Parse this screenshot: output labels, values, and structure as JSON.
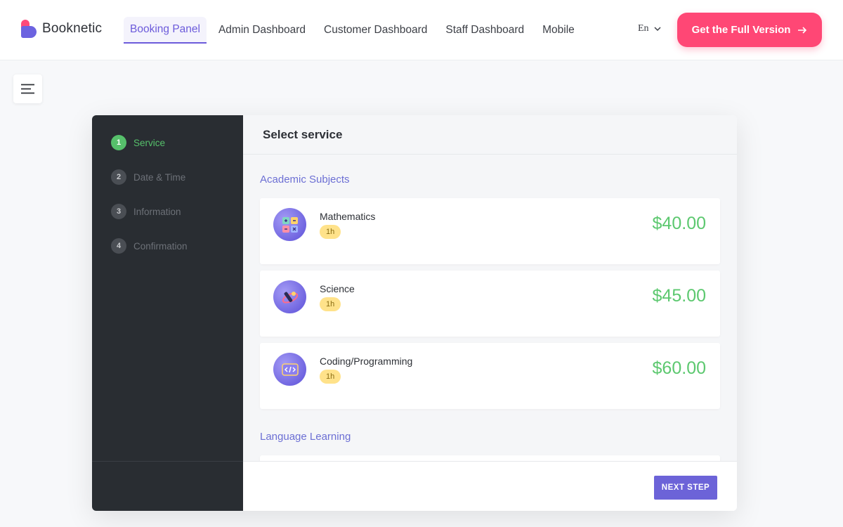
{
  "brand": {
    "name": "Booknetic"
  },
  "nav": {
    "items": [
      {
        "label": "Booking Panel",
        "active": true
      },
      {
        "label": "Admin Dashboard",
        "active": false
      },
      {
        "label": "Customer Dashboard",
        "active": false
      },
      {
        "label": "Staff Dashboard",
        "active": false
      },
      {
        "label": "Mobile",
        "active": false
      }
    ],
    "language": "En",
    "cta_label": "Get the Full Version"
  },
  "colors": {
    "accent": "#6c5bdb",
    "cta": "#ff4775",
    "price": "#5cc86f",
    "sidebar": "#292d32",
    "step_active": "#56c06b"
  },
  "steps": [
    {
      "num": "1",
      "label": "Service",
      "active": true
    },
    {
      "num": "2",
      "label": "Date & Time",
      "active": false
    },
    {
      "num": "3",
      "label": "Information",
      "active": false
    },
    {
      "num": "4",
      "label": "Confirmation",
      "active": false
    }
  ],
  "main": {
    "title": "Select service",
    "categories": [
      {
        "name": "Academic Subjects",
        "services": [
          {
            "name": "Mathematics",
            "duration": "1h",
            "price": "$40.00",
            "icon": "calculator-icon"
          },
          {
            "name": "Science",
            "duration": "1h",
            "price": "$45.00",
            "icon": "telescope-icon"
          },
          {
            "name": "Coding/Programming",
            "duration": "1h",
            "price": "$60.00",
            "icon": "code-icon"
          }
        ]
      },
      {
        "name": "Language Learning",
        "services": []
      }
    ],
    "next_label": "NEXT STEP"
  }
}
